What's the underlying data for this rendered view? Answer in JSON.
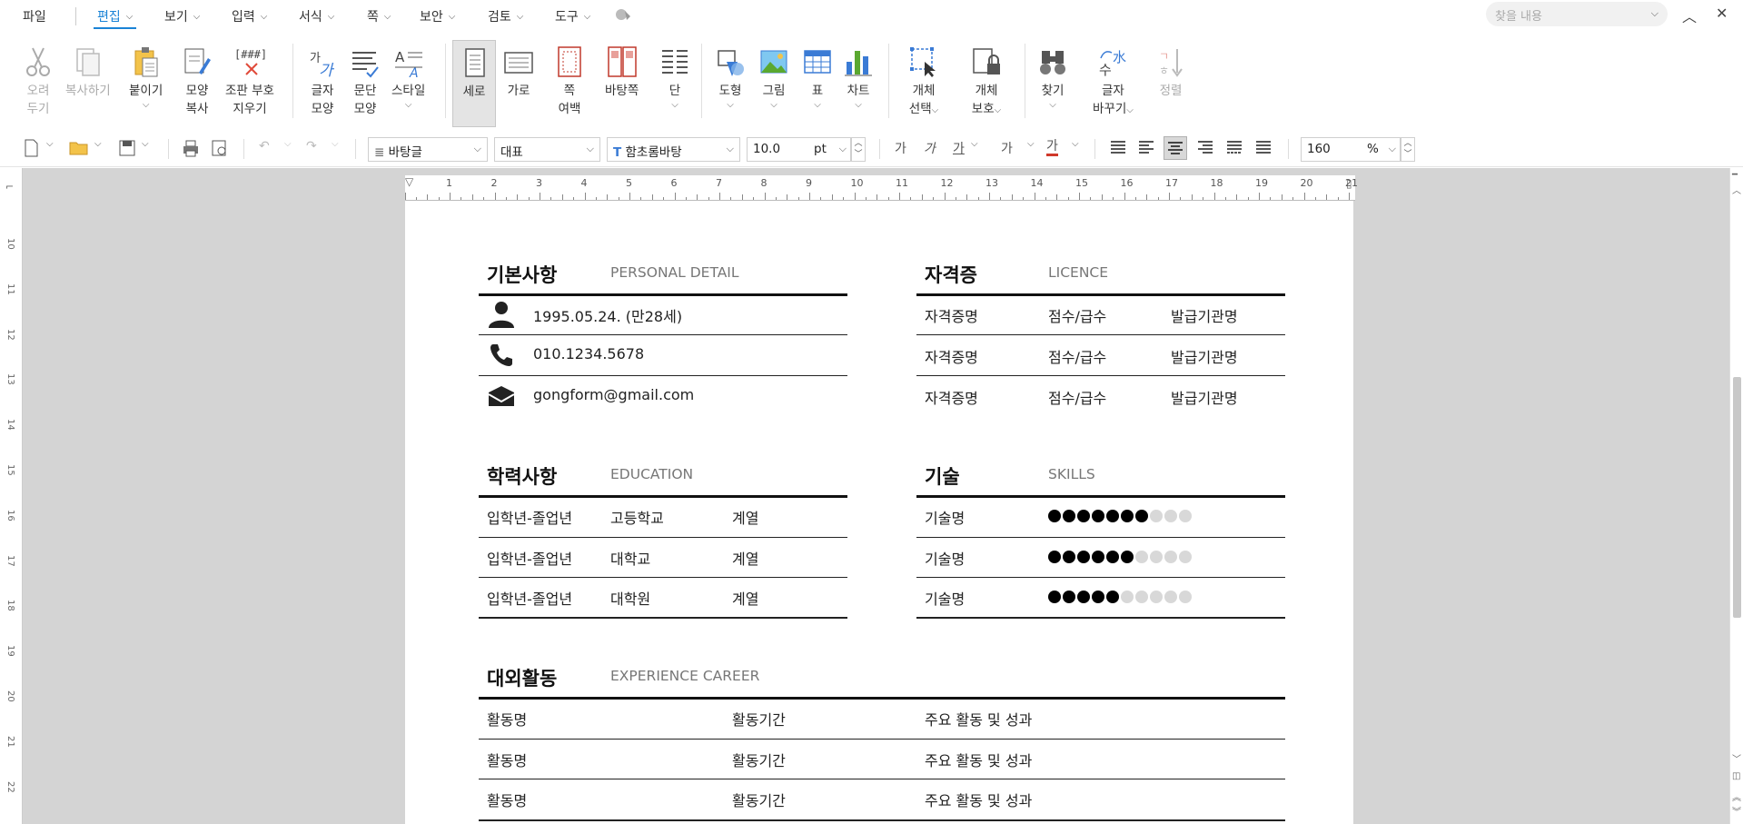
{
  "menubar": {
    "file": "파일",
    "items": [
      {
        "label": "편집",
        "active": true
      },
      {
        "label": "보기"
      },
      {
        "label": "입력"
      },
      {
        "label": "서식"
      },
      {
        "label": "쪽"
      },
      {
        "label": "보안"
      },
      {
        "label": "검토"
      },
      {
        "label": "도구"
      }
    ],
    "find_placeholder": "찾을 내용",
    "accent": "#1a83d6"
  },
  "ribbon": {
    "cut": [
      "오려",
      "두기"
    ],
    "copy": "복사하기",
    "paste": "붙이기",
    "format_copy": [
      "모양",
      "복사"
    ],
    "clear_marks": [
      "조판 부호",
      "지우기"
    ],
    "clear_marks_icon_text": "[###]",
    "char_shape": [
      "글자",
      "모양"
    ],
    "para_shape": [
      "문단",
      "모양"
    ],
    "style": "스타일",
    "portrait": "세로",
    "landscape": "가로",
    "page_margin": [
      "쪽",
      "여백"
    ],
    "page_bg": "바탕쪽",
    "columns": "단",
    "shape": "도형",
    "picture": "그림",
    "table": "표",
    "chart": "차트",
    "obj_select": [
      "개체",
      "선택"
    ],
    "obj_protect": [
      "개체",
      "보호"
    ],
    "find": "찾기",
    "char_convert": [
      "글자",
      "바꾸기"
    ],
    "sort": "정렬"
  },
  "toolbar": {
    "style": "바탕글",
    "lang": "대표",
    "font": "함초롬바탕",
    "font_size": "10.0",
    "unit": "pt",
    "zoom": "160",
    "zoom_unit": "%",
    "char_glyph": "가",
    "sup_glyph": "가"
  },
  "ruler": {
    "h_numbers": [
      "1",
      "2",
      "3",
      "4",
      "5",
      "6",
      "7",
      "8",
      "9",
      "10",
      "11",
      "12",
      "13",
      "14",
      "15",
      "16",
      "17",
      "18",
      "19",
      "20",
      "21"
    ],
    "v_numbers": [
      "10",
      "11",
      "12",
      "13",
      "14",
      "15",
      "16",
      "17",
      "18",
      "19",
      "20",
      "21",
      "22"
    ]
  },
  "doc": {
    "personal": {
      "title": "기본사항",
      "title_en": "PERSONAL DETAIL",
      "rows": [
        {
          "icon": "person-icon",
          "text": "1995.05.24. (만28세)"
        },
        {
          "icon": "phone-icon",
          "text": "010.1234.5678"
        },
        {
          "icon": "mail-icon",
          "text": "gongform@gmail.com"
        }
      ]
    },
    "licence": {
      "title": "자격증",
      "title_en": "LICENCE",
      "rows": [
        [
          "자격증명",
          "점수/급수",
          "발급기관명"
        ],
        [
          "자격증명",
          "점수/급수",
          "발급기관명"
        ],
        [
          "자격증명",
          "점수/급수",
          "발급기관명"
        ]
      ]
    },
    "education": {
      "title": "학력사항",
      "title_en": "EDUCATION",
      "rows": [
        [
          "입학년-졸업년",
          "고등학교",
          "계열"
        ],
        [
          "입학년-졸업년",
          "대학교",
          "계열"
        ],
        [
          "입학년-졸업년",
          "대학원",
          "계열"
        ]
      ]
    },
    "skills": {
      "title": "기술",
      "title_en": "SKILLS",
      "rows": [
        {
          "name": "기술명",
          "level": 7,
          "max": 10
        },
        {
          "name": "기술명",
          "level": 6,
          "max": 10
        },
        {
          "name": "기술명",
          "level": 5,
          "max": 10
        }
      ]
    },
    "career": {
      "title": "대외활동",
      "title_en": "EXPERIENCE CAREER",
      "rows": [
        [
          "활동명",
          "활동기간",
          "주요 활동 및 성과"
        ],
        [
          "활동명",
          "활동기간",
          "주요 활동 및 성과"
        ],
        [
          "활동명",
          "활동기간",
          "주요 활동 및 성과"
        ]
      ]
    }
  }
}
